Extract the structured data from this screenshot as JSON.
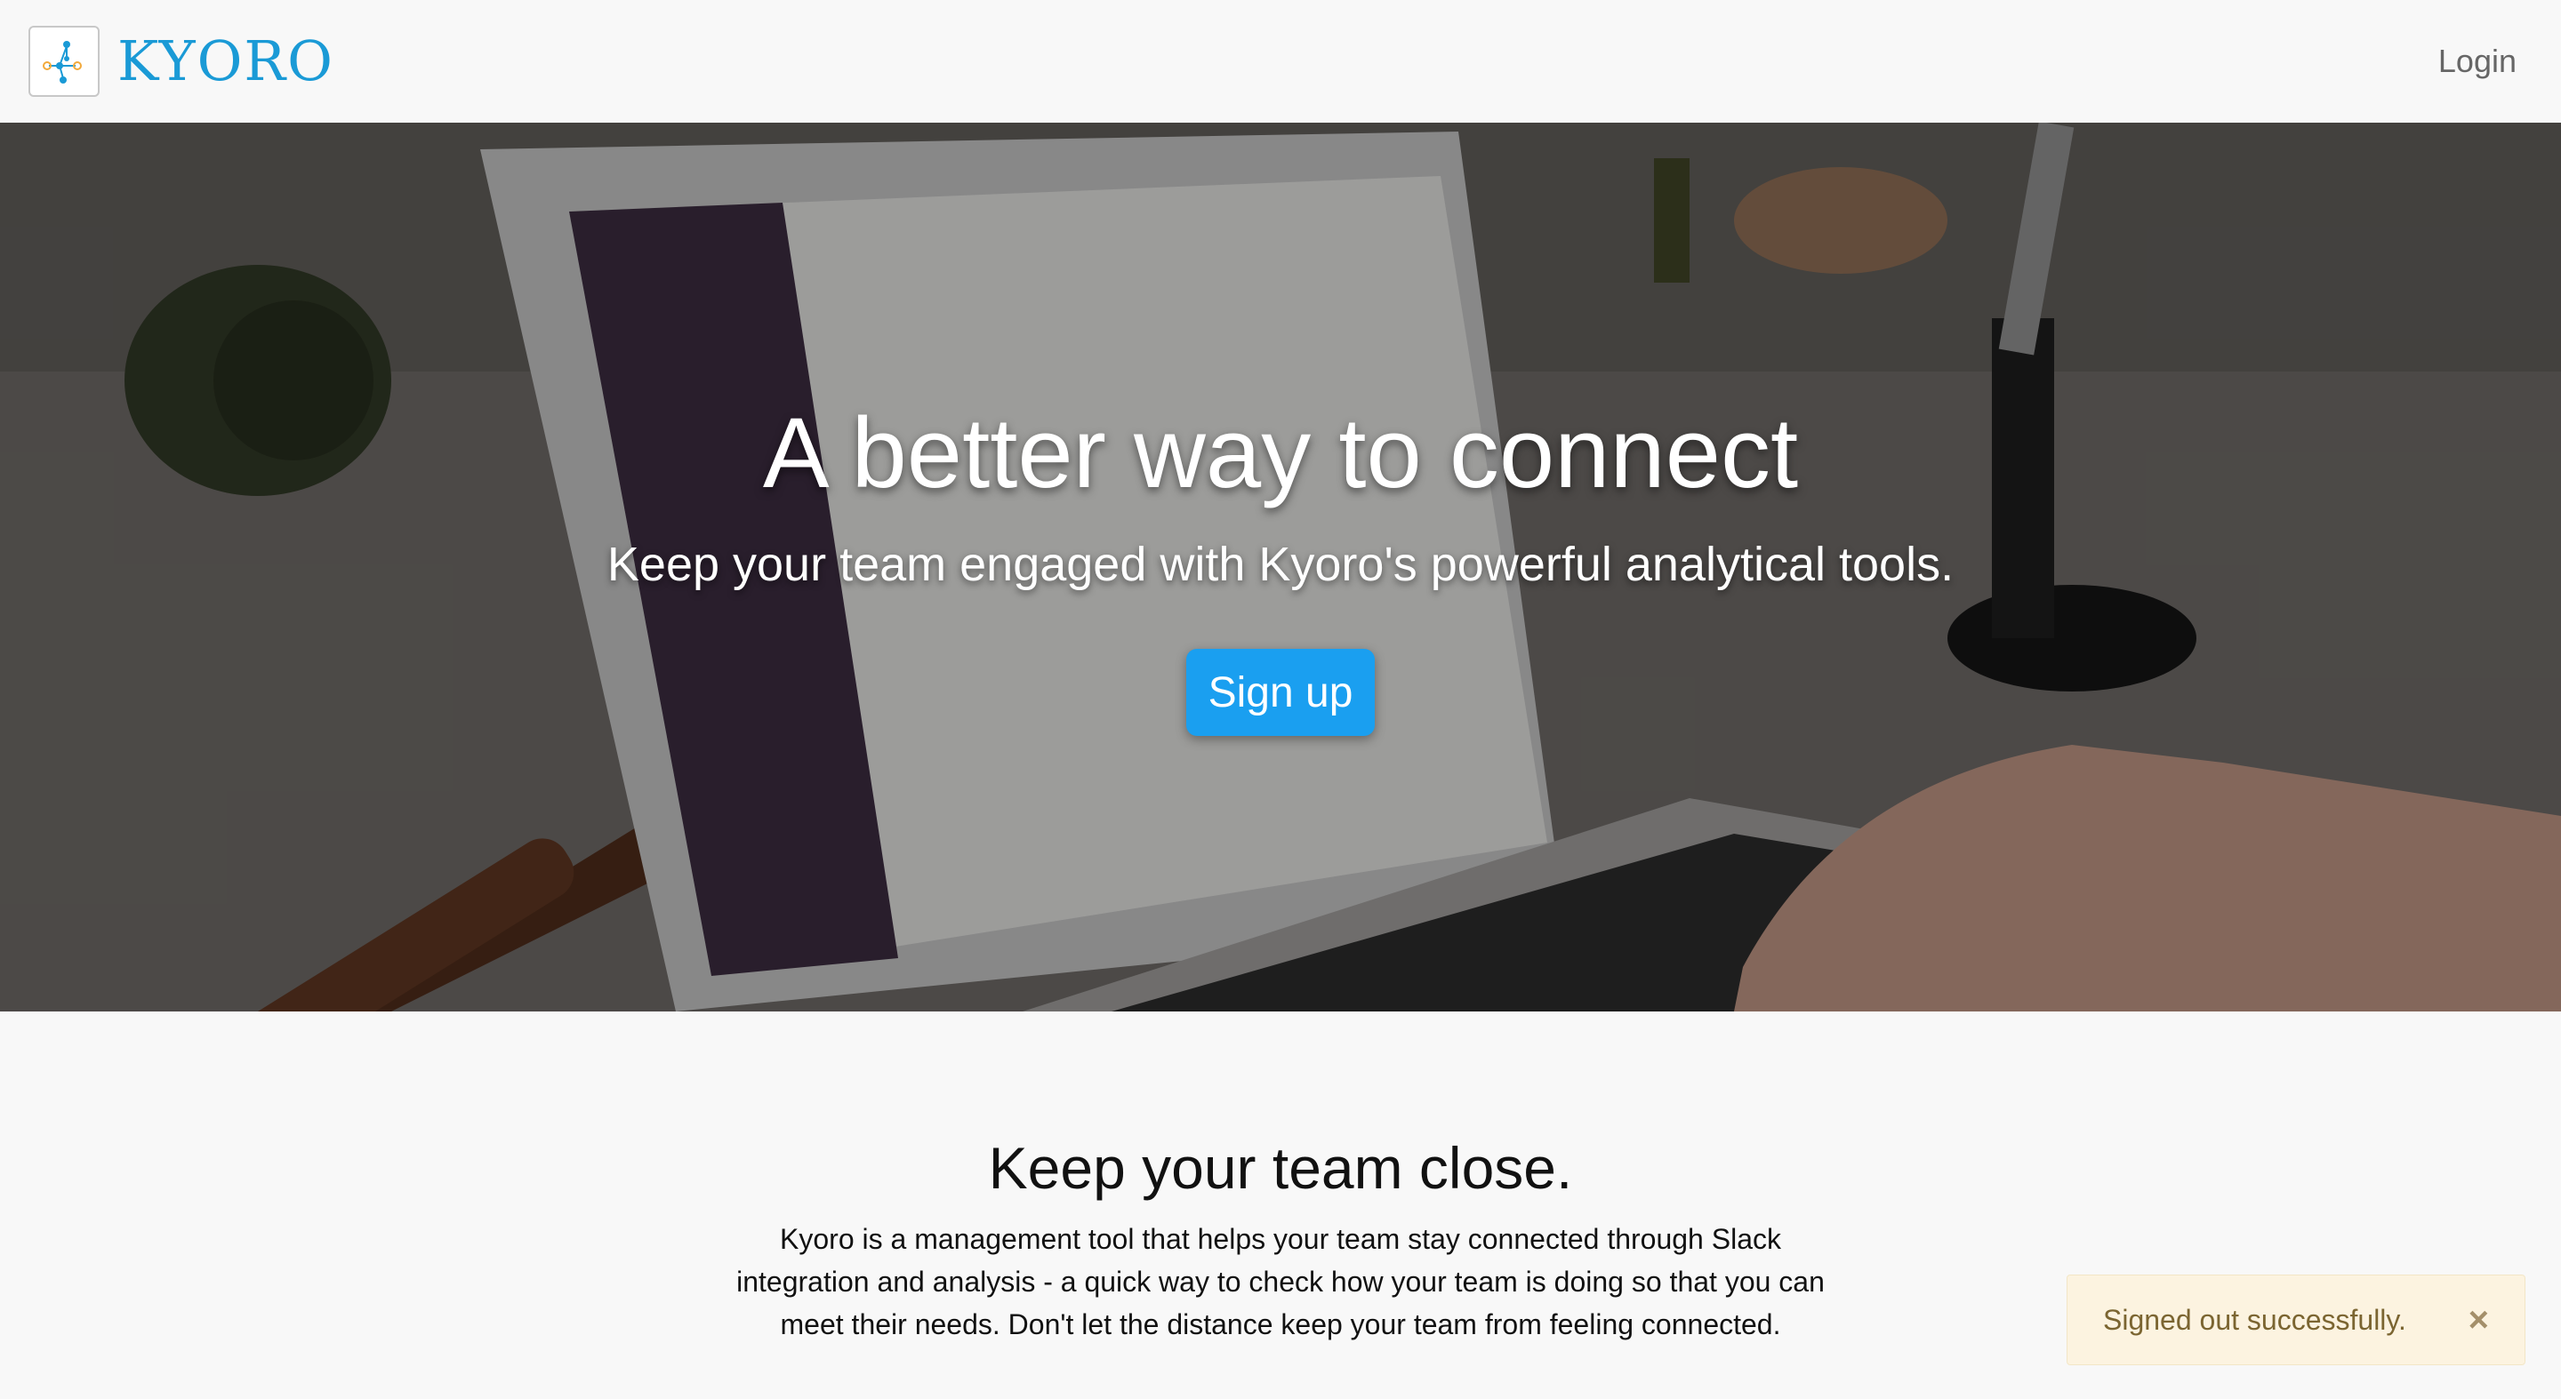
{
  "header": {
    "brand_name": "KYORO",
    "logo_icon": "network-nodes-icon",
    "login_label": "Login"
  },
  "hero": {
    "title": "A better way to connect",
    "subtitle": "Keep your team engaged with Kyoro's powerful analytical tools.",
    "signup_label": "Sign up"
  },
  "info": {
    "title": "Keep your team close.",
    "text": "Kyoro is a management tool that helps your team stay connected through Slack integration and analysis - a quick way to check how your team is doing so that you can meet their needs. Don't let the distance keep your team from feeling connected."
  },
  "toast": {
    "message": "Signed out successfully.",
    "close_icon": "×"
  },
  "colors": {
    "brand": "#1a9ad6",
    "signup_button": "#1a9ff0",
    "toast_background": "#fcf3e0",
    "toast_text": "#7b6531"
  }
}
